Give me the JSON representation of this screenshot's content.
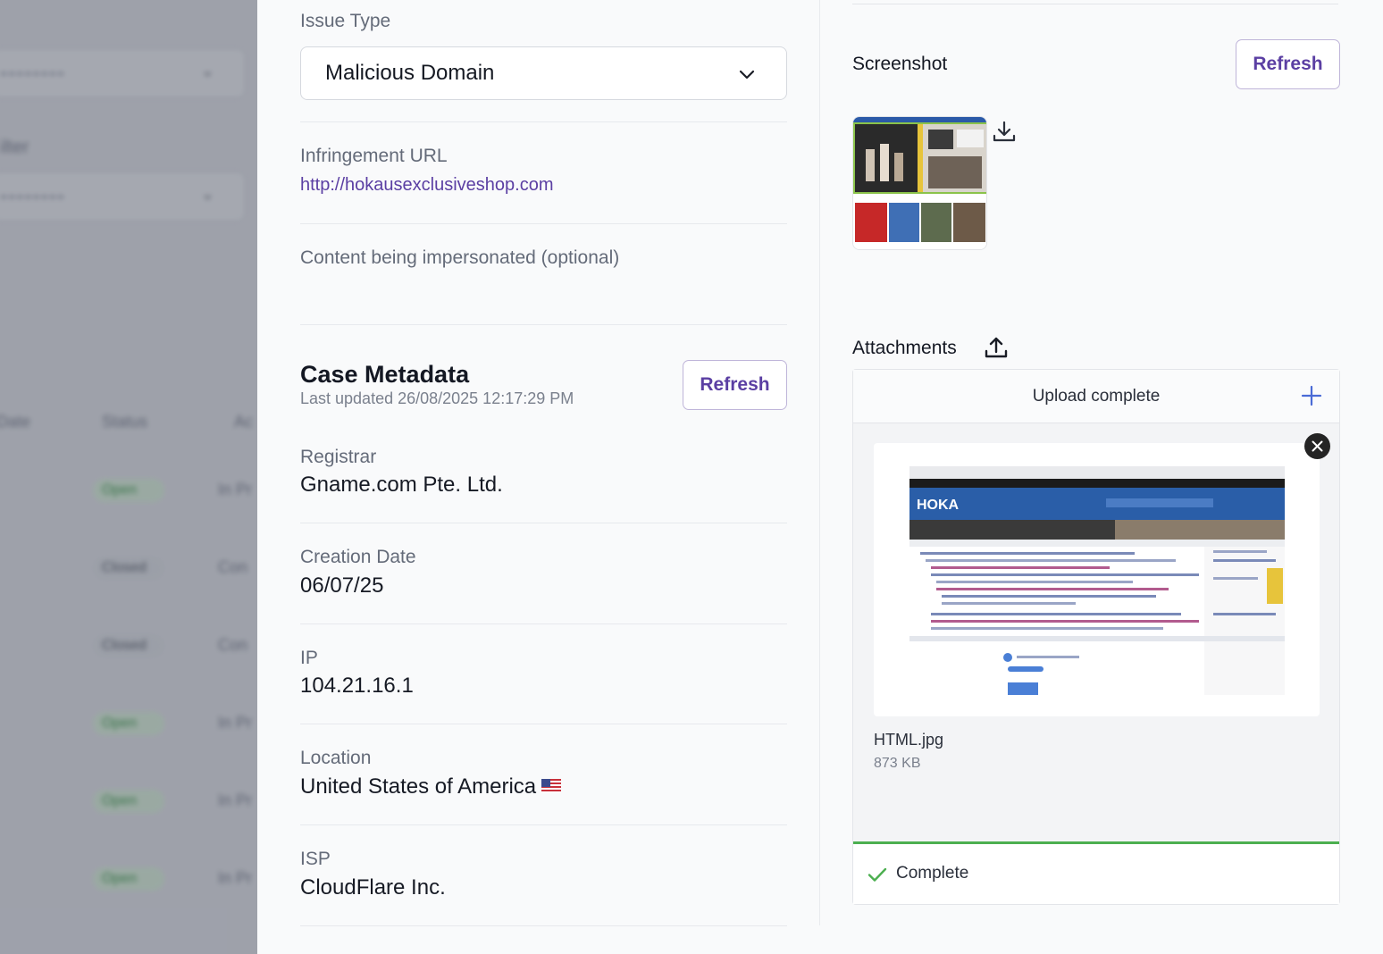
{
  "backdrop": {
    "filter_label_partial": "ilter",
    "col_date": "Date",
    "col_status": "Status",
    "col_action": "Ac",
    "rows": [
      {
        "status": "Open",
        "next": "In Pr"
      },
      {
        "status": "Closed",
        "next": "Con"
      },
      {
        "status": "Closed",
        "next": "Con"
      },
      {
        "status": "Open",
        "next": "In Pr"
      },
      {
        "status": "Open",
        "next": "In Pr"
      },
      {
        "status": "Open",
        "next": "In Pr"
      }
    ]
  },
  "issue_type": {
    "label": "Issue Type",
    "value": "Malicious Domain"
  },
  "infringement": {
    "label": "Infringement URL",
    "url": "http://hokausexclusiveshop.com"
  },
  "impersonated": {
    "label": "Content being impersonated (optional)"
  },
  "case_metadata": {
    "title": "Case Metadata",
    "last_updated": "Last updated 26/08/2025 12:17:29 PM",
    "refresh_label": "Refresh",
    "fields": {
      "registrar_label": "Registrar",
      "registrar_value": "Gname.com Pte. Ltd.",
      "creation_label": "Creation Date",
      "creation_value": "06/07/25",
      "ip_label": "IP",
      "ip_value": "104.21.16.1",
      "location_label": "Location",
      "location_value": "United States of America",
      "isp_label": "ISP",
      "isp_value": "CloudFlare Inc."
    }
  },
  "screenshot": {
    "title": "Screenshot",
    "refresh_label": "Refresh"
  },
  "attachments": {
    "title": "Attachments",
    "status_text": "Upload complete",
    "file_name": "HTML.jpg",
    "file_size": "873 KB",
    "progress": 1.0,
    "complete_text": "Complete"
  },
  "colors": {
    "accent": "#5b3fa3",
    "success": "#4caf50"
  }
}
